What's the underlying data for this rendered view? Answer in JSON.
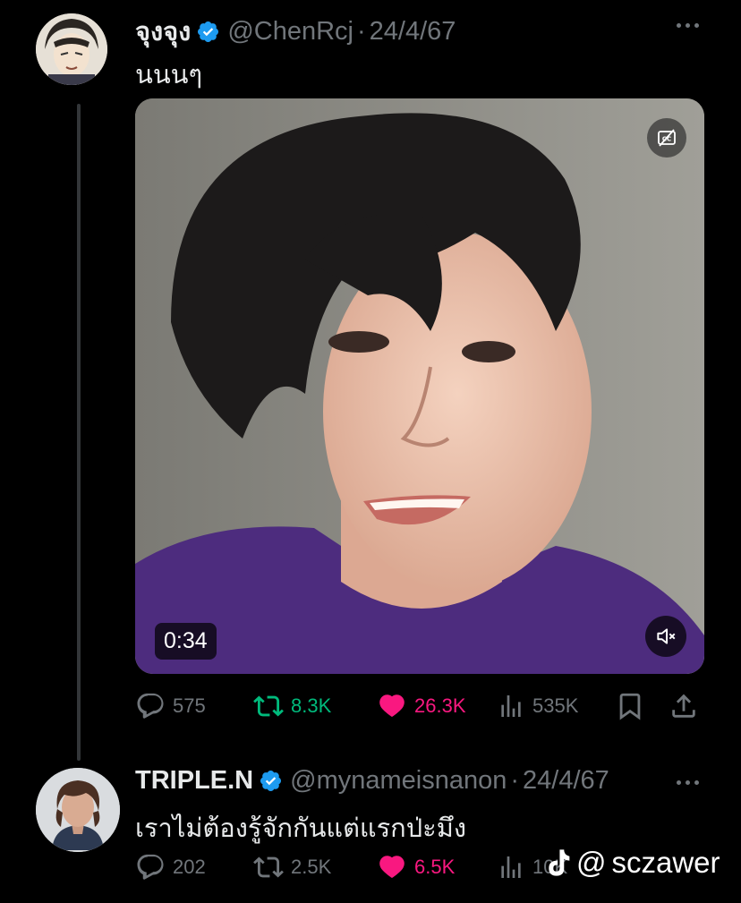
{
  "tweet1": {
    "display_name": "จุงจุง",
    "handle": "@ChenRcj",
    "sep": "·",
    "date": "24/4/67",
    "text": "นนนๆ",
    "video": {
      "duration": "0:34"
    },
    "stats": {
      "replies": "575",
      "reposts": "8.3K",
      "likes": "26.3K",
      "views": "535K"
    }
  },
  "tweet2": {
    "display_name": "TRIPLE.N",
    "handle": "@mynameisnanon",
    "sep": "·",
    "date": "24/4/67",
    "text": "เราไม่ต้องรู้จักกันแต่แรกป่ะมึง",
    "stats": {
      "replies": "202",
      "reposts": "2.5K",
      "likes": "6.5K",
      "views": "10K"
    }
  },
  "watermark": {
    "at": "@",
    "name": "sczawer"
  },
  "colors": {
    "background": "#000000",
    "text": "#e7e9ea",
    "muted": "#71767b",
    "verified": "#1d9bf0",
    "repost": "#00ba7c",
    "like": "#f91880"
  },
  "icons": [
    "verified-badge-icon",
    "more-icon",
    "captions-off-icon",
    "mute-icon",
    "reply-icon",
    "repost-icon",
    "like-icon",
    "views-icon",
    "bookmark-icon",
    "share-icon",
    "tiktok-icon"
  ]
}
